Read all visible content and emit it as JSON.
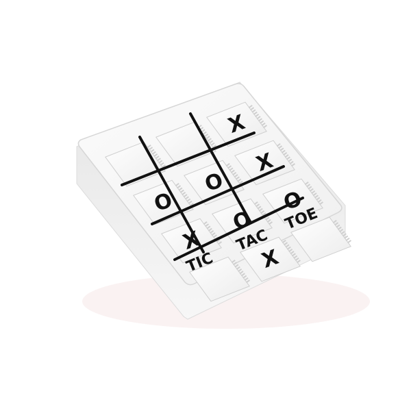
{
  "game": {
    "labels": {
      "tic": "TIC",
      "tac": "TAC",
      "toe": "TOE"
    },
    "board": [
      [
        "",
        "",
        "X"
      ],
      [
        "O",
        "O",
        "X"
      ],
      [
        "X",
        "O",
        "O"
      ],
      [
        "",
        "X",
        ""
      ]
    ],
    "cells_flat": [
      "",
      "",
      "X",
      "O",
      "O",
      "X",
      "X",
      "O",
      "O",
      "",
      "X",
      ""
    ]
  },
  "colors": {
    "body": "#f4f4f4",
    "edge": "#d9d9d9",
    "grid_line": "#111111",
    "mark": "#111111",
    "shadow": "#f3e6e6"
  }
}
